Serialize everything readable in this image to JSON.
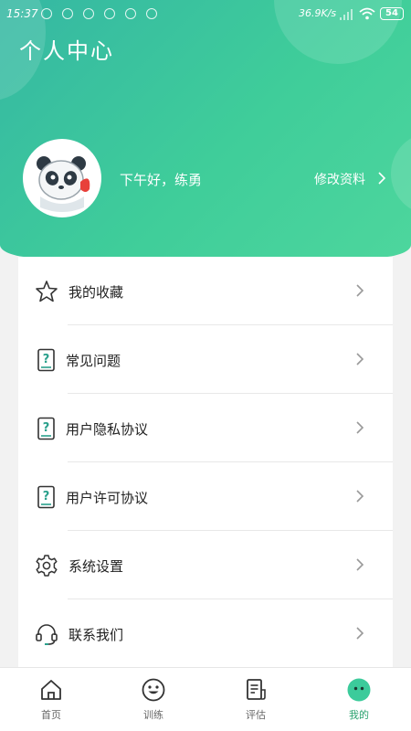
{
  "status_bar": {
    "time": "15:37",
    "network_speed": "36.9K/s",
    "battery": "54"
  },
  "header": {
    "title": "个人中心",
    "greeting": "下午好，练勇",
    "edit_profile": "修改资料"
  },
  "menu": [
    {
      "label": "我的收藏",
      "icon": "star-icon"
    },
    {
      "label": "常见问题",
      "icon": "question-doc-icon"
    },
    {
      "label": "用户隐私协议",
      "icon": "question-doc-icon"
    },
    {
      "label": "用户许可协议",
      "icon": "question-doc-icon"
    },
    {
      "label": "系统设置",
      "icon": "gear-icon"
    },
    {
      "label": "联系我们",
      "icon": "headset-icon"
    }
  ],
  "tabs": [
    {
      "label": "首页",
      "icon": "home-icon",
      "active": false
    },
    {
      "label": "训练",
      "icon": "smile-icon",
      "active": false
    },
    {
      "label": "评估",
      "icon": "document-icon",
      "active": false
    },
    {
      "label": "我的",
      "icon": "face-icon",
      "active": true
    }
  ],
  "colors": {
    "accent": "#3ccb9b",
    "accent_dark": "#2aa26e",
    "icon_teal": "#2aa08c"
  }
}
